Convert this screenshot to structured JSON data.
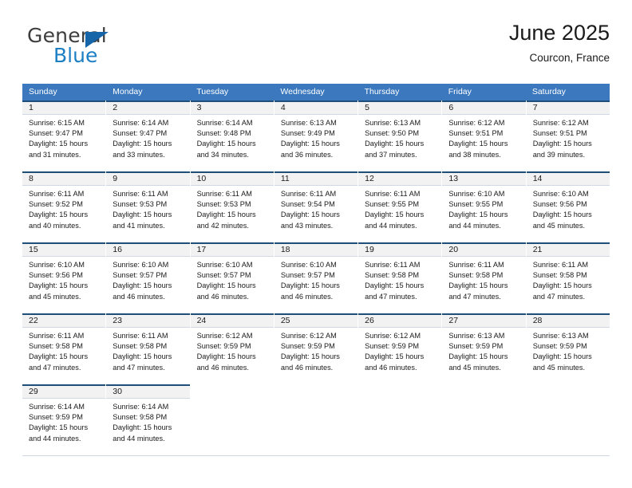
{
  "brand": {
    "name_top": "General",
    "name_bottom": "Blue",
    "triangle_icon": "blue-triangle-icon",
    "color_top": "#3d3d3d",
    "color_bottom": "#1c7fc4",
    "triangle_color": "#1565a8"
  },
  "header": {
    "title": "June 2025",
    "subtitle": "Courcon, France"
  },
  "theme": {
    "header_row_bg": "#3b78be",
    "daynum_band_bg": "#f2f2f2",
    "daynum_top_border": "#1f4e79",
    "text": "#1a1a1a"
  },
  "weekdays": [
    "Sunday",
    "Monday",
    "Tuesday",
    "Wednesday",
    "Thursday",
    "Friday",
    "Saturday"
  ],
  "weeks": [
    [
      {
        "day": "1",
        "lines": [
          "Sunrise: 6:15 AM",
          "Sunset: 9:47 PM",
          "Daylight: 15 hours",
          "and 31 minutes."
        ]
      },
      {
        "day": "2",
        "lines": [
          "Sunrise: 6:14 AM",
          "Sunset: 9:47 PM",
          "Daylight: 15 hours",
          "and 33 minutes."
        ]
      },
      {
        "day": "3",
        "lines": [
          "Sunrise: 6:14 AM",
          "Sunset: 9:48 PM",
          "Daylight: 15 hours",
          "and 34 minutes."
        ]
      },
      {
        "day": "4",
        "lines": [
          "Sunrise: 6:13 AM",
          "Sunset: 9:49 PM",
          "Daylight: 15 hours",
          "and 36 minutes."
        ]
      },
      {
        "day": "5",
        "lines": [
          "Sunrise: 6:13 AM",
          "Sunset: 9:50 PM",
          "Daylight: 15 hours",
          "and 37 minutes."
        ]
      },
      {
        "day": "6",
        "lines": [
          "Sunrise: 6:12 AM",
          "Sunset: 9:51 PM",
          "Daylight: 15 hours",
          "and 38 minutes."
        ]
      },
      {
        "day": "7",
        "lines": [
          "Sunrise: 6:12 AM",
          "Sunset: 9:51 PM",
          "Daylight: 15 hours",
          "and 39 minutes."
        ]
      }
    ],
    [
      {
        "day": "8",
        "lines": [
          "Sunrise: 6:11 AM",
          "Sunset: 9:52 PM",
          "Daylight: 15 hours",
          "and 40 minutes."
        ]
      },
      {
        "day": "9",
        "lines": [
          "Sunrise: 6:11 AM",
          "Sunset: 9:53 PM",
          "Daylight: 15 hours",
          "and 41 minutes."
        ]
      },
      {
        "day": "10",
        "lines": [
          "Sunrise: 6:11 AM",
          "Sunset: 9:53 PM",
          "Daylight: 15 hours",
          "and 42 minutes."
        ]
      },
      {
        "day": "11",
        "lines": [
          "Sunrise: 6:11 AM",
          "Sunset: 9:54 PM",
          "Daylight: 15 hours",
          "and 43 minutes."
        ]
      },
      {
        "day": "12",
        "lines": [
          "Sunrise: 6:11 AM",
          "Sunset: 9:55 PM",
          "Daylight: 15 hours",
          "and 44 minutes."
        ]
      },
      {
        "day": "13",
        "lines": [
          "Sunrise: 6:10 AM",
          "Sunset: 9:55 PM",
          "Daylight: 15 hours",
          "and 44 minutes."
        ]
      },
      {
        "day": "14",
        "lines": [
          "Sunrise: 6:10 AM",
          "Sunset: 9:56 PM",
          "Daylight: 15 hours",
          "and 45 minutes."
        ]
      }
    ],
    [
      {
        "day": "15",
        "lines": [
          "Sunrise: 6:10 AM",
          "Sunset: 9:56 PM",
          "Daylight: 15 hours",
          "and 45 minutes."
        ]
      },
      {
        "day": "16",
        "lines": [
          "Sunrise: 6:10 AM",
          "Sunset: 9:57 PM",
          "Daylight: 15 hours",
          "and 46 minutes."
        ]
      },
      {
        "day": "17",
        "lines": [
          "Sunrise: 6:10 AM",
          "Sunset: 9:57 PM",
          "Daylight: 15 hours",
          "and 46 minutes."
        ]
      },
      {
        "day": "18",
        "lines": [
          "Sunrise: 6:10 AM",
          "Sunset: 9:57 PM",
          "Daylight: 15 hours",
          "and 46 minutes."
        ]
      },
      {
        "day": "19",
        "lines": [
          "Sunrise: 6:11 AM",
          "Sunset: 9:58 PM",
          "Daylight: 15 hours",
          "and 47 minutes."
        ]
      },
      {
        "day": "20",
        "lines": [
          "Sunrise: 6:11 AM",
          "Sunset: 9:58 PM",
          "Daylight: 15 hours",
          "and 47 minutes."
        ]
      },
      {
        "day": "21",
        "lines": [
          "Sunrise: 6:11 AM",
          "Sunset: 9:58 PM",
          "Daylight: 15 hours",
          "and 47 minutes."
        ]
      }
    ],
    [
      {
        "day": "22",
        "lines": [
          "Sunrise: 6:11 AM",
          "Sunset: 9:58 PM",
          "Daylight: 15 hours",
          "and 47 minutes."
        ]
      },
      {
        "day": "23",
        "lines": [
          "Sunrise: 6:11 AM",
          "Sunset: 9:58 PM",
          "Daylight: 15 hours",
          "and 47 minutes."
        ]
      },
      {
        "day": "24",
        "lines": [
          "Sunrise: 6:12 AM",
          "Sunset: 9:59 PM",
          "Daylight: 15 hours",
          "and 46 minutes."
        ]
      },
      {
        "day": "25",
        "lines": [
          "Sunrise: 6:12 AM",
          "Sunset: 9:59 PM",
          "Daylight: 15 hours",
          "and 46 minutes."
        ]
      },
      {
        "day": "26",
        "lines": [
          "Sunrise: 6:12 AM",
          "Sunset: 9:59 PM",
          "Daylight: 15 hours",
          "and 46 minutes."
        ]
      },
      {
        "day": "27",
        "lines": [
          "Sunrise: 6:13 AM",
          "Sunset: 9:59 PM",
          "Daylight: 15 hours",
          "and 45 minutes."
        ]
      },
      {
        "day": "28",
        "lines": [
          "Sunrise: 6:13 AM",
          "Sunset: 9:59 PM",
          "Daylight: 15 hours",
          "and 45 minutes."
        ]
      }
    ],
    [
      {
        "day": "29",
        "lines": [
          "Sunrise: 6:14 AM",
          "Sunset: 9:59 PM",
          "Daylight: 15 hours",
          "and 44 minutes."
        ]
      },
      {
        "day": "30",
        "lines": [
          "Sunrise: 6:14 AM",
          "Sunset: 9:58 PM",
          "Daylight: 15 hours",
          "and 44 minutes."
        ]
      },
      {
        "day": "",
        "lines": []
      },
      {
        "day": "",
        "lines": []
      },
      {
        "day": "",
        "lines": []
      },
      {
        "day": "",
        "lines": []
      },
      {
        "day": "",
        "lines": []
      }
    ]
  ]
}
